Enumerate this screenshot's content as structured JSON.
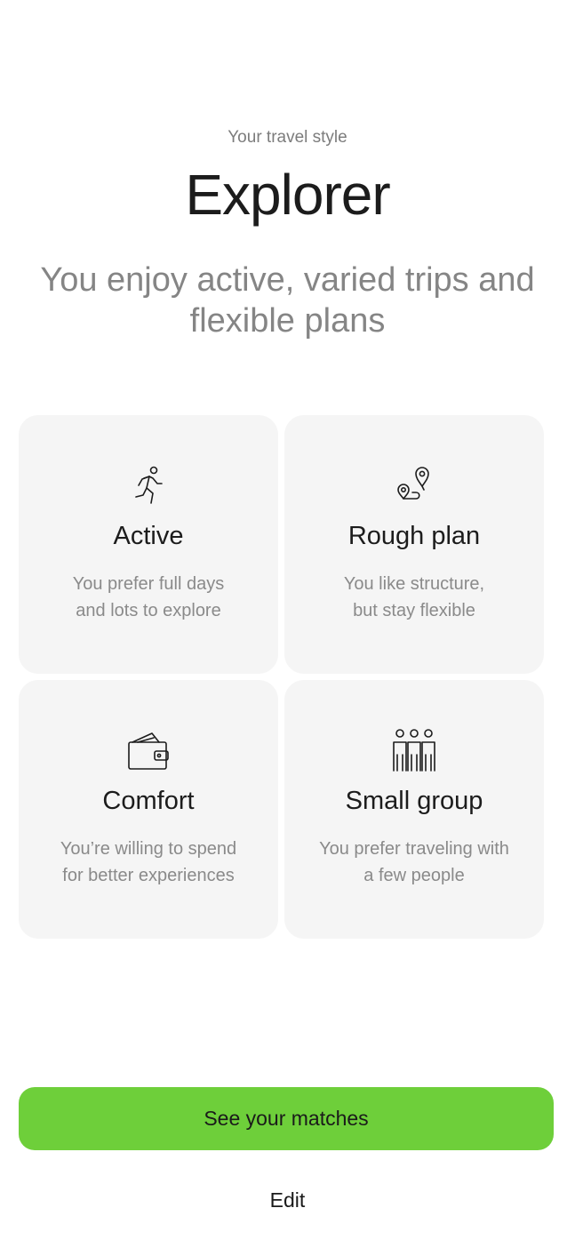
{
  "header": {
    "eyebrow": "Your travel style",
    "title": "Explorer",
    "subtitle": "You enjoy active, varied trips and flexible plans"
  },
  "traits": [
    {
      "icon": "running-person-icon",
      "title": "Active",
      "description_line1": "You prefer full days",
      "description_line2": "and lots to explore"
    },
    {
      "icon": "map-route-pins-icon",
      "title": "Rough plan",
      "description_line1": "You like structure,",
      "description_line2": "but stay flexible"
    },
    {
      "icon": "wallet-icon",
      "title": "Comfort",
      "description_line1": "You’re willing to spend",
      "description_line2": "for better experiences"
    },
    {
      "icon": "group-people-icon",
      "title": "Small group",
      "description_line1": "You prefer traveling with",
      "description_line2": "a few people"
    }
  ],
  "actions": {
    "primary_label": "See your matches",
    "secondary_label": "Edit"
  },
  "colors": {
    "accent": "#6ecf3a",
    "card_background": "#f5f5f5",
    "muted_text": "#858585"
  }
}
